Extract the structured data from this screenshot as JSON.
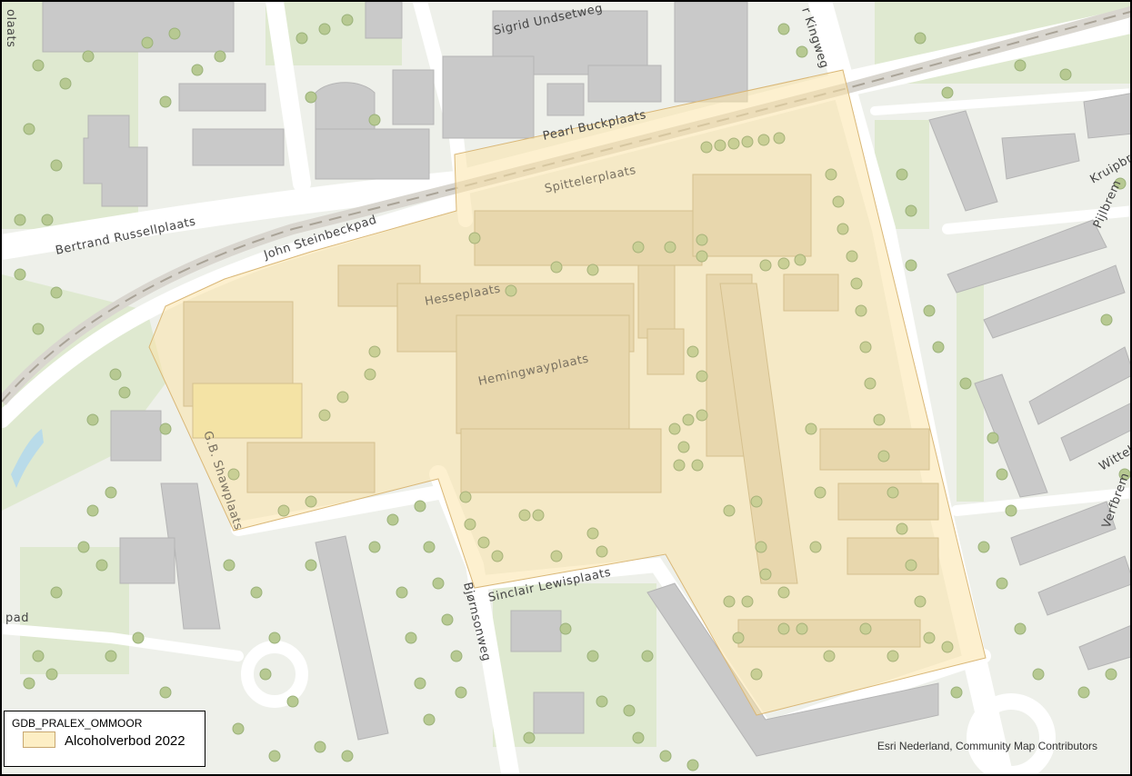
{
  "legend": {
    "title": "GDB_PRALEX_OMMOOR",
    "item_label": "Alcoholverbod 2022",
    "item_color": "#fdeec4"
  },
  "attribution": "Esri Nederland, Community Map Contributors",
  "streets": {
    "sigrid": "Sigrid Undsetweg",
    "kingweg": "r Kingweg",
    "pearl": "Pearl Buckplaats",
    "spitteler": "Spittelerplaats",
    "bertrand": "Bertrand Russellplaats",
    "steinbeck": "John Steinbeckpad",
    "hesse": "Hesseplaats",
    "hemingway": "Hemingwayplaats",
    "shaw": "G.B. Shawplaats",
    "bjornson": "Bjørnsonweg",
    "sinclair": "Sinclair Lewisplaats",
    "kruip": "Kruipbr",
    "pijl": "Pijlbrem",
    "witteb": "Witteb",
    "verf": "Verfbrem",
    "laats": "olaats",
    "pad": "pad"
  },
  "colors": {
    "background": "#eef0ea",
    "building": "#c9c9c9",
    "road": "#ffffff",
    "green": "#dfe9d0",
    "tree": "#b7c992",
    "zone_fill": "#fbe3a8",
    "zone_stroke": "#d9b777"
  }
}
